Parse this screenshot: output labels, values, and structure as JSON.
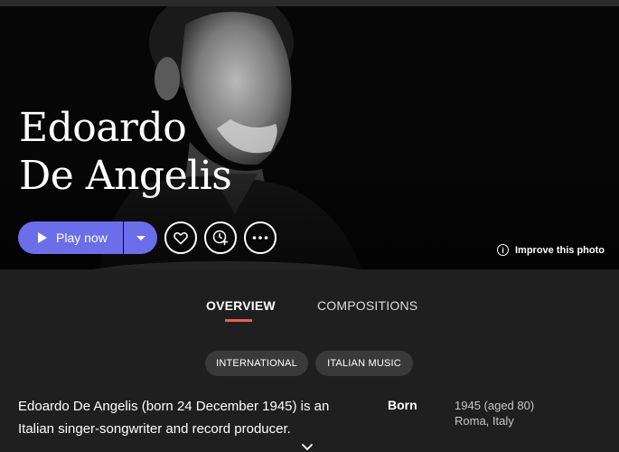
{
  "artist": {
    "name_line1": "Edoardo",
    "name_line2": "De Angelis"
  },
  "actions": {
    "play_label": "Play now",
    "improve_label": "Improve this photo"
  },
  "tabs": [
    {
      "label": "OVERVIEW",
      "active": true
    },
    {
      "label": "COMPOSITIONS",
      "active": false
    }
  ],
  "genres": [
    "INTERNATIONAL",
    "ITALIAN MUSIC"
  ],
  "bio": {
    "text": "Edoardo De Angelis (born 24 December 1945) is an Italian singer-songwriter and record producer."
  },
  "facts": {
    "born_label": "Born",
    "born_date": "1945 (aged 80)",
    "born_place": "Roma, Italy"
  },
  "colors": {
    "accent": "#6b6ee8",
    "tab_underline": "#e0604d",
    "background": "#1f1f1f"
  }
}
